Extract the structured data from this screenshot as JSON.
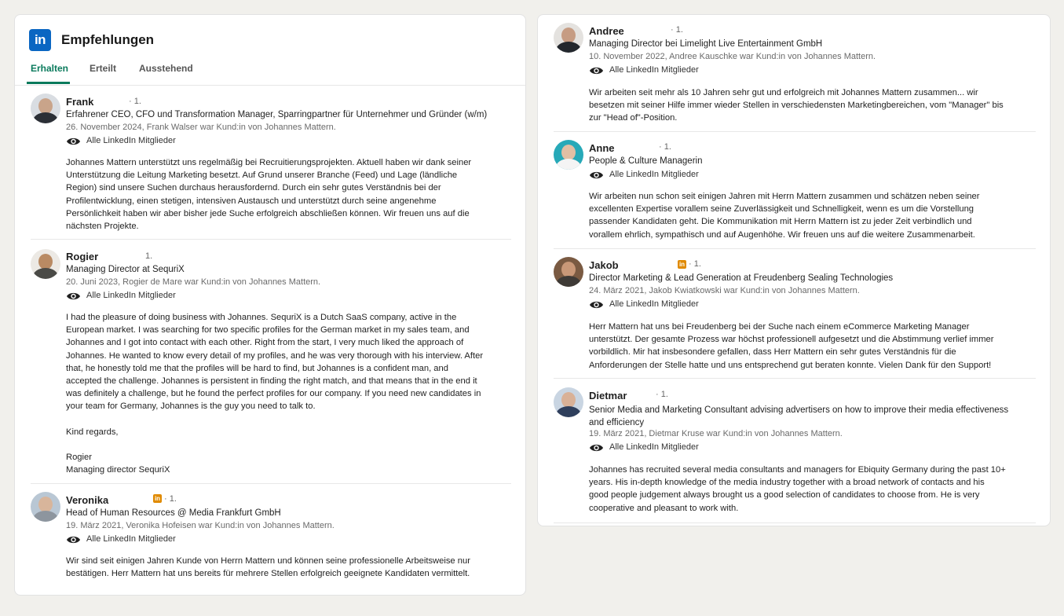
{
  "header": {
    "title": "Empfehlungen",
    "logo_text": "in"
  },
  "tabs": [
    {
      "label": "Erhalten",
      "active": true
    },
    {
      "label": "Erteilt",
      "active": false
    },
    {
      "label": "Ausstehend",
      "active": false
    }
  ],
  "visibility_label": "Alle LinkedIn Mitglieder",
  "colors": {
    "linkedin_blue": "#0a66c2",
    "active_tab": "#0a7a5c",
    "badge_orange": "#e08a00"
  },
  "recommendations": [
    {
      "name": "Frank",
      "degree": "· 1.",
      "headline": "Erfahrener CEO, CFO und Transformation Manager, Sparringpartner für Unternehmer und Gründer (w/m)",
      "meta": "26. November 2024, Frank Walser war Kund:in von Johannes Mattern.",
      "text": "Johannes Mattern unterstützt uns regelmäßig bei Recruitierungsprojekten. Aktuell haben wir dank seiner\nUnterstützung die Leitung Marketing besetzt. Auf Grund unserer Branche (Feed) und Lage (ländliche\nRegion) sind unsere Suchen durchaus herausfordernd. Durch ein sehr gutes Verständnis bei der\nProfilentwicklung, einen stetigen, intensiven Austausch und unterstützt durch seine angenehme\nPersönlichkeit haben wir aber bisher jede Suche erfolgreich abschließen können. Wir freuen uns auf die\nnächsten Projekte."
    },
    {
      "name": "Rogier",
      "degree": "1.",
      "headline": "Managing Director at SequriX",
      "meta": "20. Juni 2023, Rogier de Mare war Kund:in von Johannes Mattern.",
      "text": "I had the pleasure of doing business with Johannes. SequriX is a Dutch SaaS company, active in the\nEuropean market. I was searching for two specific profiles for the German market in my sales team, and\nJohannes and I got into contact with each other. Right from the start, I very much liked the approach of\nJohannes. He wanted to know every detail of my profiles, and he was very thorough with his interview. After\nthat, he honestly told me that the profiles will be hard to find, but Johannes is a confident man, and\naccepted the challenge. Johannes is persistent in finding the right match, and that means that in the end it\nwas definitely a challenge, but he found the perfect profiles for our company. If you need new candidates in\nyour team for Germany, Johannes is the guy you need to talk to.\n\nKind regards,\n\nRogier\nManaging director SequriX"
    },
    {
      "name": "Veronika",
      "degree": "· 1.",
      "badge": "in",
      "headline": "Head of Human Resources @ Media Frankfurt GmbH",
      "meta": "19. März 2021, Veronika Hofeisen war Kund:in von Johannes Mattern.",
      "text": "Wir sind seit einigen Jahren Kunde von Herrn Mattern und können seine professionelle Arbeitsweise nur\nbestätigen. Herr Mattern hat uns bereits für mehrere Stellen erfolgreich geeignete Kandidaten vermittelt."
    },
    {
      "name": "Andree",
      "degree": "· 1.",
      "headline": "Managing Director bei Limelight Live Entertainment GmbH",
      "meta": "10. November 2022, Andree Kauschke war Kund:in von Johannes Mattern.",
      "text": "Wir arbeiten seit mehr als 10 Jahren sehr gut und erfolgreich mit Johannes Mattern zusammen... wir\nbesetzen mit seiner Hilfe immer wieder Stellen in verschiedensten Marketingbereichen, vom \"Manager\" bis\nzur \"Head of\"-Position."
    },
    {
      "name": "Anne",
      "degree": "· 1.",
      "headline": "People & Culture Managerin",
      "meta": "",
      "text": "Wir arbeiten nun schon seit einigen Jahren mit Herrn Mattern zusammen und schätzen neben seiner\nexcellenten Expertise vorallem seine Zuverlässigkeit und Schnelligkeit, wenn es um die Vorstellung\npassender Kandidaten geht. Die Kommunikation mit Herrn Mattern ist zu jeder Zeit verbindlich und\nvorallem ehrlich, sympathisch und auf Augenhöhe. Wir freuen uns auf die weitere Zusammenarbeit."
    },
    {
      "name": "Jakob",
      "degree": "· 1.",
      "badge": "in",
      "headline": "Director Marketing & Lead Generation at Freudenberg Sealing Technologies",
      "meta": "24. März 2021, Jakob Kwiatkowski war Kund:in von Johannes Mattern.",
      "text": "Herr Mattern hat uns bei Freudenberg bei der Suche nach einem eCommerce Marketing Manager\nunterstützt. Der gesamte Prozess war höchst professionell aufgesetzt und die Abstimmung verlief immer\nvorbildlich. Mir hat insbesondere gefallen, dass Herr Mattern ein sehr gutes Verständnis für die\nAnforderungen der Stelle hatte und uns entsprechend gut beraten konnte. Vielen Dank für den Support!"
    },
    {
      "name": "Dietmar",
      "degree": "· 1.",
      "headline": "Senior Media and Marketing Consultant advising advertisers on how to improve their media effectiveness\nand efficiency",
      "meta": "19. März 2021, Dietmar Kruse war Kund:in von Johannes Mattern.",
      "text": "Johannes has recruited several media consultants and managers for Ebiquity Germany during the past 10+\nyears. His in-depth knowledge of the media industry together with a broad network of contacts and his\ngood people judgement always brought us a good selection of candidates to choose from. He is very\ncooperative and pleasant to work with."
    }
  ]
}
